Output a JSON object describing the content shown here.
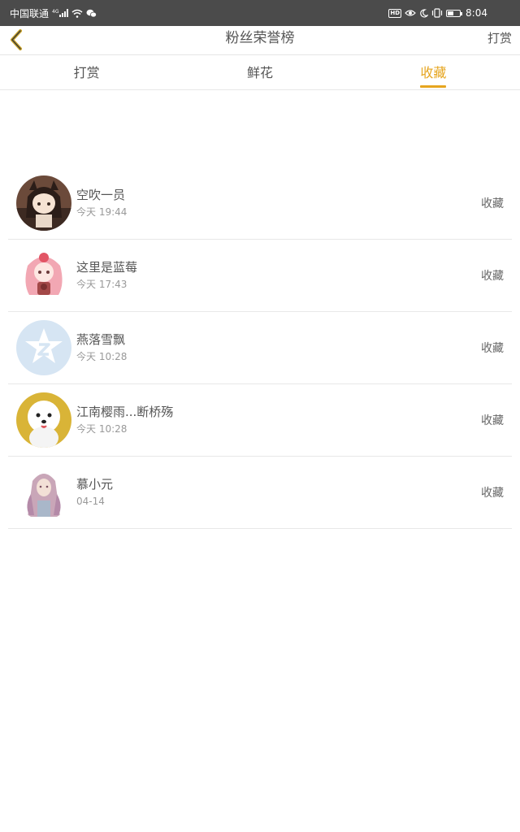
{
  "status_bar": {
    "carrier": "中国联通",
    "network": "4G",
    "time": "8:04",
    "hd_label": "HD"
  },
  "nav": {
    "title": "粉丝荣誉榜",
    "action": "打赏"
  },
  "tabs": [
    {
      "label": "打赏",
      "active": false
    },
    {
      "label": "鲜花",
      "active": false
    },
    {
      "label": "收藏",
      "active": true
    }
  ],
  "accent_color": "#e6a51f",
  "list": [
    {
      "name": "空吹一员",
      "time": "今天 19:44",
      "action": "收藏",
      "avatar": "anime-girl-avatar"
    },
    {
      "name": "这里是蓝莓",
      "time": "今天 17:43",
      "action": "收藏",
      "avatar": "pink-doll-avatar"
    },
    {
      "name": "燕落雪飘",
      "time": "今天 10:28",
      "action": "收藏",
      "avatar": "qq-star-avatar"
    },
    {
      "name": "江南樱雨...断桥殇",
      "time": "今天 10:28",
      "action": "收藏",
      "avatar": "white-dog-avatar"
    },
    {
      "name": "慕小元",
      "time": "04-14",
      "action": "收藏",
      "avatar": "painted-girl-avatar"
    }
  ]
}
